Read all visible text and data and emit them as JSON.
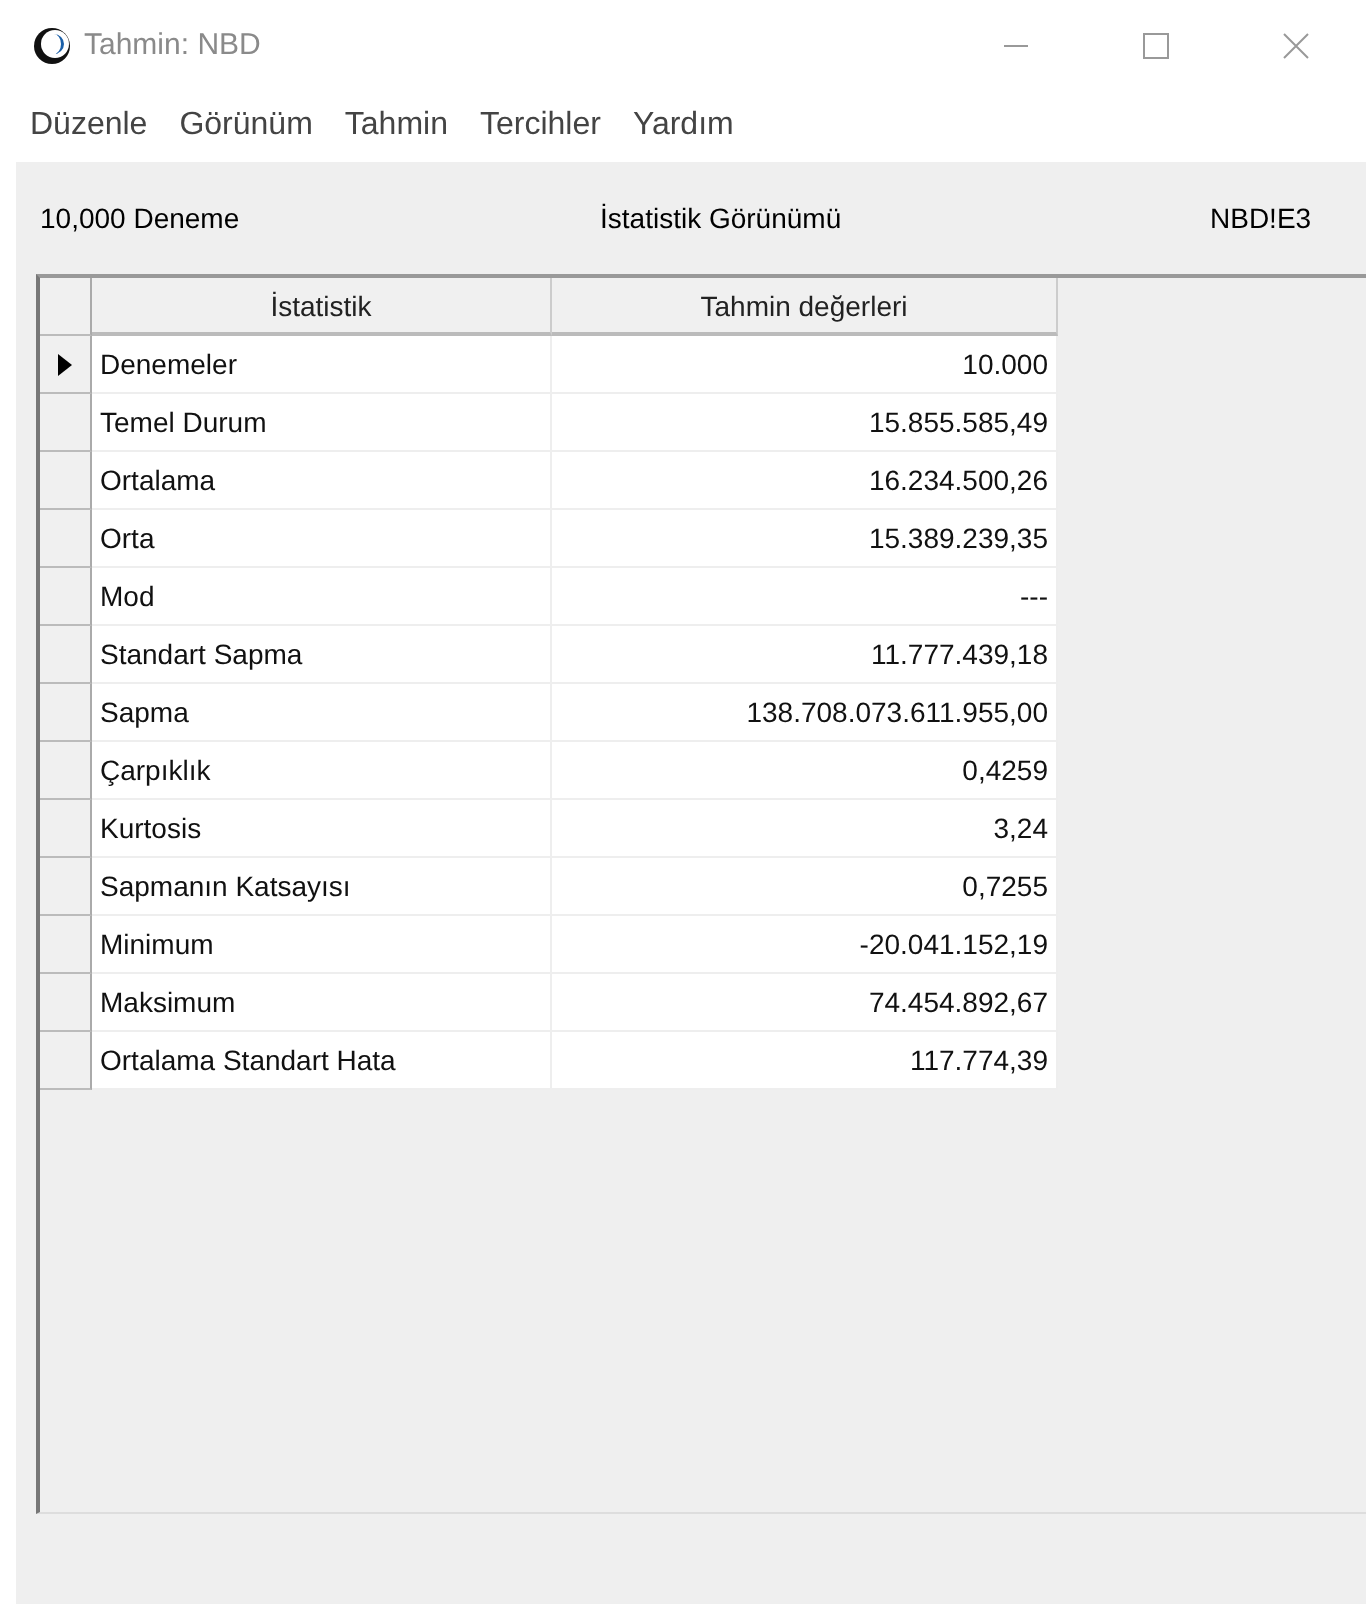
{
  "window": {
    "title": "Tahmin: NBD"
  },
  "menu": [
    "Düzenle",
    "Görünüm",
    "Tahmin",
    "Tercihler",
    "Yardım"
  ],
  "info_bar": {
    "trials": "10,000 Deneme",
    "view": "İstatistik Görünümü",
    "cell": "NBD!E3"
  },
  "table": {
    "columns": [
      "İstatistik",
      "Tahmin değerleri"
    ],
    "rows": [
      {
        "label": "Denemeler",
        "value": "10.000",
        "selected": true
      },
      {
        "label": "Temel Durum",
        "value": "15.855.585,49",
        "selected": false
      },
      {
        "label": "Ortalama",
        "value": "16.234.500,26",
        "selected": false
      },
      {
        "label": "Orta",
        "value": "15.389.239,35",
        "selected": false
      },
      {
        "label": "Mod",
        "value": "---",
        "selected": false
      },
      {
        "label": "Standart Sapma",
        "value": "11.777.439,18",
        "selected": false
      },
      {
        "label": "Sapma",
        "value": "138.708.073.611.955,00",
        "selected": false
      },
      {
        "label": "Çarpıklık",
        "value": "0,4259",
        "selected": false
      },
      {
        "label": "Kurtosis",
        "value": "3,24",
        "selected": false
      },
      {
        "label": "Sapmanın Katsayısı",
        "value": "0,7255",
        "selected": false
      },
      {
        "label": "Minimum",
        "value": "-20.041.152,19",
        "selected": false
      },
      {
        "label": "Maksimum",
        "value": "74.454.892,67",
        "selected": false
      },
      {
        "label": "Ortalama Standart Hata",
        "value": "117.774,39",
        "selected": false
      }
    ]
  }
}
